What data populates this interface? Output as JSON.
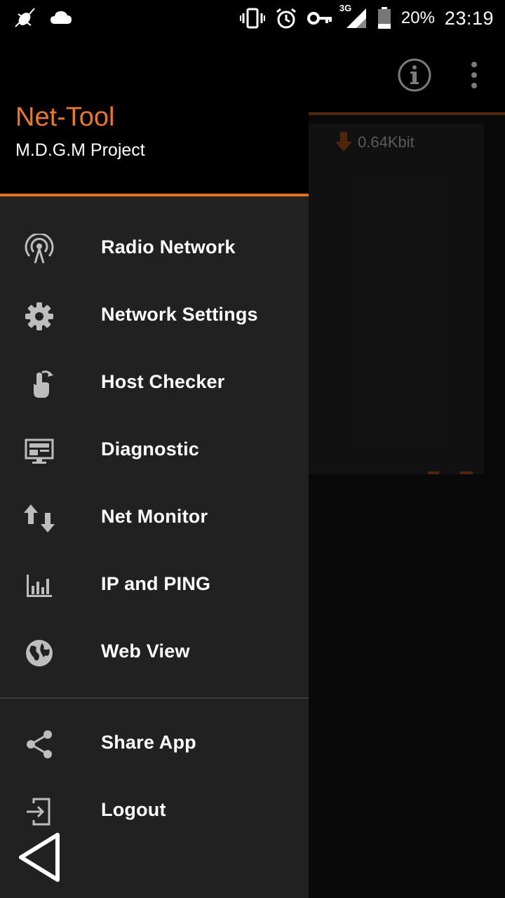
{
  "status_bar": {
    "battery_percent": "20%",
    "network_type": "3G",
    "time": "23:19",
    "icons": [
      "bug-icon",
      "cloud-icon",
      "vibrate-icon",
      "alarm-icon",
      "vpn-key-icon",
      "signal-icon",
      "battery-icon"
    ]
  },
  "drawer": {
    "app_title": "Net-Tool",
    "app_subtitle": "M.D.G.M Project",
    "items": [
      {
        "label": "Radio Network",
        "icon": "radio-tower-icon"
      },
      {
        "label": "Network Settings",
        "icon": "gear-icon"
      },
      {
        "label": "Host Checker",
        "icon": "tap-hand-icon"
      },
      {
        "label": "Diagnostic",
        "icon": "monitor-icon"
      },
      {
        "label": "Net Monitor",
        "icon": "up-down-arrows-icon"
      },
      {
        "label": "IP and PING",
        "icon": "bar-chart-icon"
      },
      {
        "label": "Web View",
        "icon": "globe-icon"
      }
    ],
    "secondary_items": [
      {
        "label": "Share App",
        "icon": "share-icon"
      },
      {
        "label": "Logout",
        "icon": "logout-icon"
      }
    ]
  },
  "background_app": {
    "download_speed": "0.64Kbit"
  },
  "colors": {
    "accent": "#e8782a",
    "drawer_bg": "#212121",
    "header_bg": "#000000"
  }
}
